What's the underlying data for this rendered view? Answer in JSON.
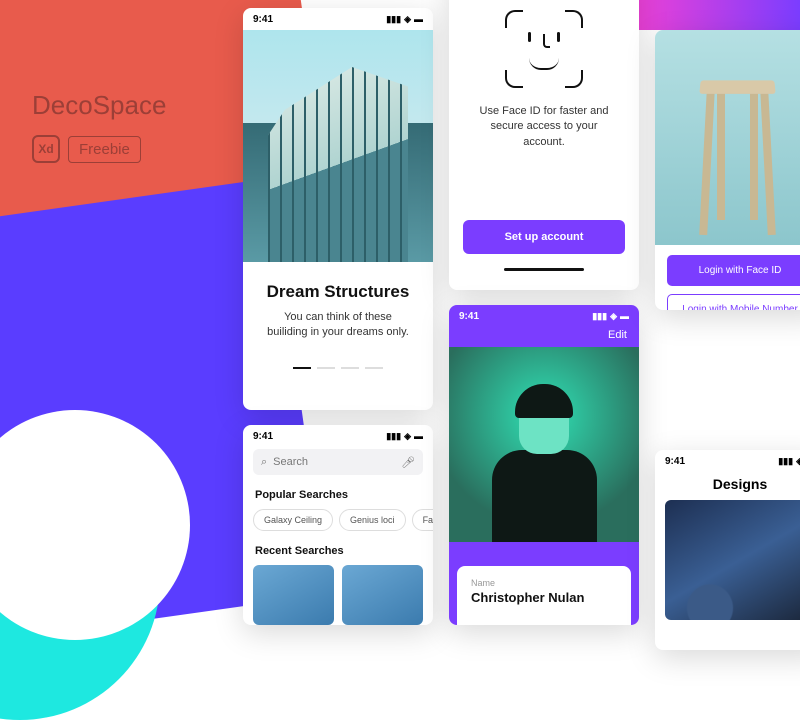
{
  "logo": {
    "title": "DecoSpace",
    "xd": "Xd",
    "freebie": "Freebie"
  },
  "colors": {
    "accent": "#7B3DFF",
    "red": "#E85B4C",
    "cyan": "#1EE8E0"
  },
  "status": {
    "time": "9:41"
  },
  "screen1": {
    "title": "Dream Structures",
    "text": "You can think of these builiding in your dreams only."
  },
  "screen2": {
    "search_placeholder": "Search",
    "popular_label": "Popular Searches",
    "chips": [
      "Galaxy Ceiling",
      "Genius loci",
      "Facade"
    ],
    "recent_label": "Recent Searches"
  },
  "screen3": {
    "text": "Use Face ID for faster and secure access to your account.",
    "button": "Set up account"
  },
  "screen4": {
    "edit": "Edit",
    "name_label": "Name",
    "name": "Christopher Nulan"
  },
  "screen5": {
    "login_faceid": "Login with Face ID",
    "login_mobile": "Login with Mobile Number"
  },
  "screen6": {
    "title": "Designs"
  }
}
